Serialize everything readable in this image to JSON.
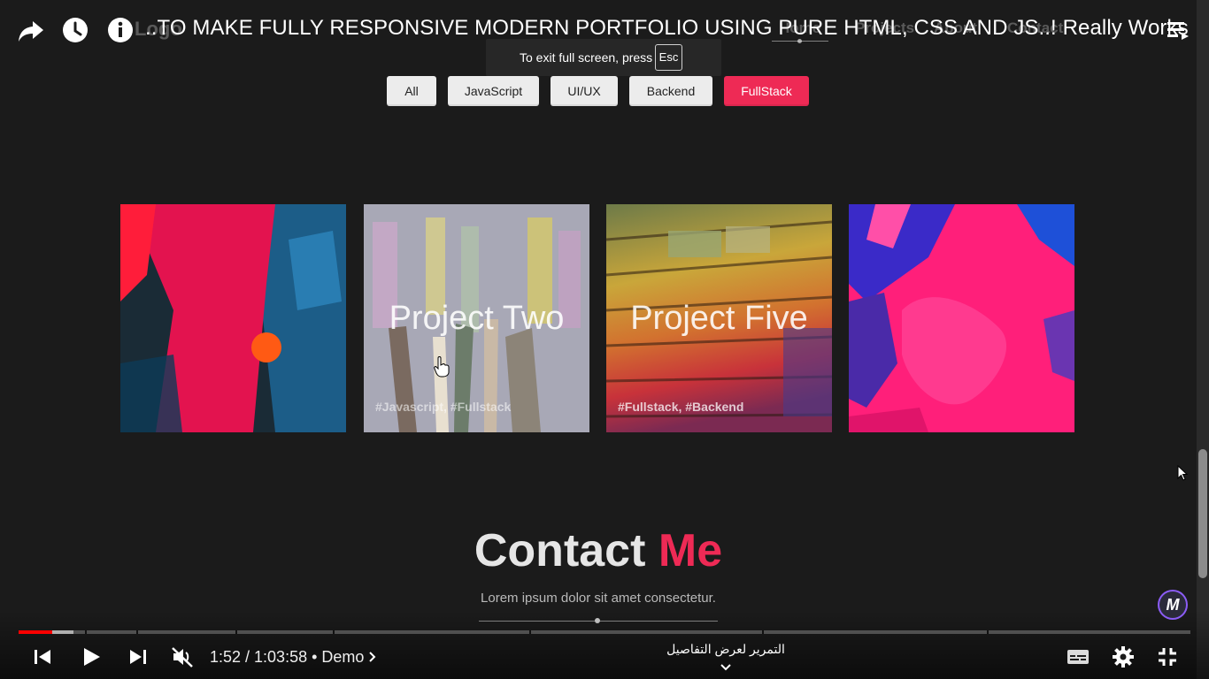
{
  "video": {
    "title": "..TO MAKE FULLY RESPONSIVE MODERN PORTFOLIO USING PURE HTML, CSS AND JS..! Really Works",
    "fullscreen_notice": "To exit full screen, press",
    "fullscreen_key": "Esc"
  },
  "site_nav_ghost": {
    "logo": "Logo",
    "items": [
      "Home",
      "Projects",
      "About",
      "Contact"
    ]
  },
  "filters": [
    {
      "label": "All",
      "active": false
    },
    {
      "label": "JavaScript",
      "active": false
    },
    {
      "label": "UI/UX",
      "active": false
    },
    {
      "label": "Backend",
      "active": false
    },
    {
      "label": "FullStack",
      "active": true
    }
  ],
  "projects": [
    {
      "title": "",
      "tags": ""
    },
    {
      "title": "Project Two",
      "tags": "#Javascript, #Fullstack"
    },
    {
      "title": "Project Five",
      "tags": "#Fullstack, #Backend"
    },
    {
      "title": "",
      "tags": ""
    }
  ],
  "contact": {
    "title_main": "Contact",
    "title_accent": "Me",
    "subtitle": "Lorem ipsum dolor sit amet consectetur."
  },
  "player": {
    "current_time": "1:52",
    "duration": "1:03:58",
    "chapter": "Demo",
    "time_text": "1:52 / 1:03:58 • Demo",
    "scroll_hint": "التمرير لعرض التفاصيل",
    "played_fraction": 0.029,
    "buffered_fraction": 0.047,
    "muted": true,
    "playing": false
  },
  "colors": {
    "accent": "#ee2a55",
    "progress": "#ff0000",
    "background": "#1b1b1b"
  },
  "icons": [
    "share-icon",
    "watch-later-icon",
    "info-icon",
    "playlist-icon",
    "previous-icon",
    "play-icon",
    "next-icon",
    "mute-icon",
    "chevron-right-icon",
    "chevron-down-icon",
    "subtitles-icon",
    "settings-icon",
    "exit-fullscreen-icon",
    "channel-logo-icon",
    "mouse-cursor-icon",
    "hand-cursor-icon"
  ]
}
